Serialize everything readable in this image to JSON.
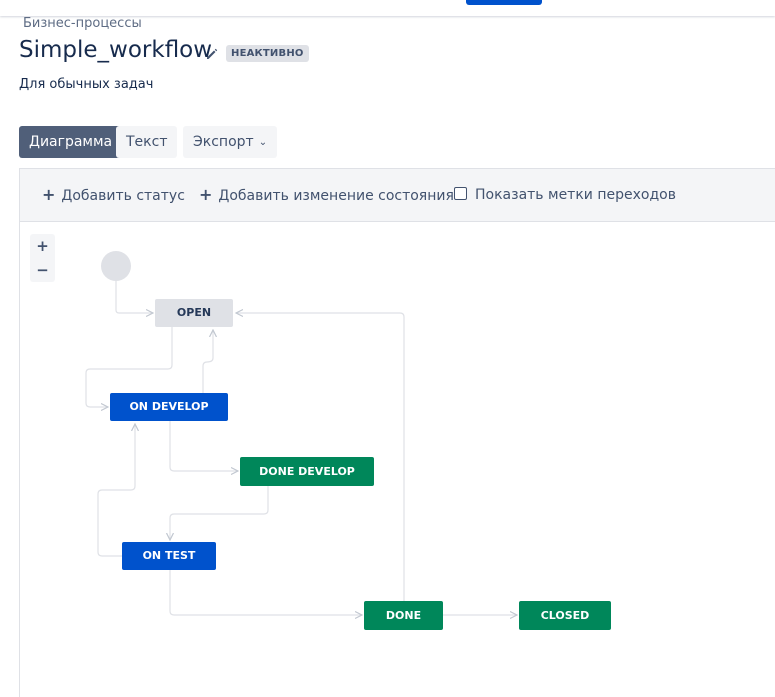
{
  "header": {
    "breadcrumb": "Бизнес-процессы",
    "title": "Simple_workflow",
    "status": "НЕАКТИВНО",
    "description": "Для обычных задач"
  },
  "tabs": {
    "diagram": "Диаграмма",
    "text": "Текст",
    "export": "Экспорт"
  },
  "toolbar": {
    "add_status": "Добавить статус",
    "add_transition": "Добавить изменение состояния",
    "show_labels": "Показать метки переходов",
    "show_labels_checked": false
  },
  "zoom": {
    "in": "+",
    "out": "−"
  },
  "workflow": {
    "statuses": {
      "open": "OPEN",
      "on_develop": "ON DEVELOP",
      "done_develop": "DONE DEVELOP",
      "on_test": "ON TEST",
      "done": "DONE",
      "closed": "CLOSED"
    }
  },
  "colors": {
    "todo": "#dfe1e6",
    "in_progress": "#0052cc",
    "done": "#00875a",
    "active_tab": "#505f79"
  }
}
